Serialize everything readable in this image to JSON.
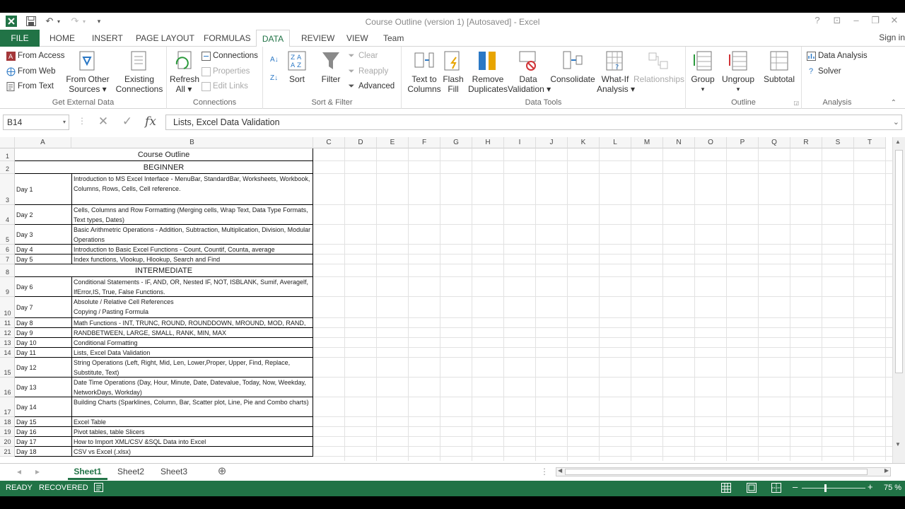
{
  "window": {
    "title": "Course Outline (version 1) [Autosaved] - Excel",
    "help": "?",
    "restore_ribbon": "⊡",
    "minimize": "–",
    "maximize": "❐",
    "close": "✕",
    "signin": "Sign in"
  },
  "qat": {
    "undo": "↶",
    "redo": "↷",
    "customize": "▾"
  },
  "tabs": [
    "FILE",
    "HOME",
    "INSERT",
    "PAGE LAYOUT",
    "FORMULAS",
    "DATA",
    "REVIEW",
    "VIEW",
    "Team"
  ],
  "ribbon": {
    "get_external": {
      "label": "Get External Data",
      "from_access": "From Access",
      "from_web": "From Web",
      "from_text": "From Text",
      "other_l1": "From Other",
      "other_l2": "Sources",
      "existing_l1": "Existing",
      "existing_l2": "Connections"
    },
    "connections": {
      "label": "Connections",
      "refresh_l1": "Refresh",
      "refresh_l2": "All",
      "connections": "Connections",
      "properties": "Properties",
      "edit_links": "Edit Links"
    },
    "sort_filter": {
      "label": "Sort & Filter",
      "sort": "Sort",
      "filter": "Filter",
      "clear": "Clear",
      "reapply": "Reapply",
      "advanced": "Advanced"
    },
    "data_tools": {
      "label": "Data Tools",
      "ttc_l1": "Text to",
      "ttc_l2": "Columns",
      "flash_l1": "Flash",
      "flash_l2": "Fill",
      "remove_l1": "Remove",
      "remove_l2": "Duplicates",
      "dv_l1": "Data",
      "dv_l2": "Validation",
      "consolidate": "Consolidate",
      "whatif_l1": "What-If",
      "whatif_l2": "Analysis",
      "relationships": "Relationships"
    },
    "outline": {
      "label": "Outline",
      "group": "Group",
      "ungroup": "Ungroup",
      "subtotal": "Subtotal"
    },
    "analysis": {
      "label": "Analysis",
      "data_analysis": "Data Analysis",
      "solver": "Solver"
    }
  },
  "formula_bar": {
    "name_box": "B14",
    "cancel": "✕",
    "enter": "✓",
    "fx": "fx",
    "value": "Lists, Excel Data Validation"
  },
  "columns": [
    "A",
    "B",
    "C",
    "D",
    "E",
    "F",
    "G",
    "H",
    "I",
    "J",
    "K",
    "L",
    "M",
    "N",
    "O",
    "P",
    "Q",
    "R",
    "S",
    "T"
  ],
  "rows": [
    {
      "n": "1",
      "b": "Course Outline"
    },
    {
      "n": "2",
      "b": "BEGINNER"
    },
    {
      "n": "3",
      "a": "Day 1",
      "b": "Introduction to MS Excel Interface - MenuBar, StandardBar, Worksheets, Workbook, Columns, Rows, Cells, Cell reference."
    },
    {
      "n": "4",
      "a": "Day 2",
      "b": "Cells, Columns and Row Formatting (Merging cells, Wrap Text, Data Type Formats, Text types, Dates)"
    },
    {
      "n": "5",
      "a": "Day 3",
      "b": "Basic Arithmetric Operations - Addition, Subtraction, Multiplication, Division, Modular Operations"
    },
    {
      "n": "6",
      "a": "Day 4",
      "b": "Introduction to Basic Excel Functions - Count, Countif, Counta, average"
    },
    {
      "n": "7",
      "a": "Day 5",
      "b": "Index functions, Vlookup, Hlookup, Search and Find"
    },
    {
      "n": "8",
      "b": "INTERMEDIATE"
    },
    {
      "n": "9",
      "a": "Day 6",
      "b": "Conditional Statements - IF, AND, OR, Nested IF, NOT, ISBLANK, Sumif, Averagelf, IfError,IS, True, False  Functions."
    },
    {
      "n": "10",
      "a": "Day 7",
      "b": "Absolute / Relative Cell References\nCopying / Pasting Formula"
    },
    {
      "n": "11",
      "a": "Day 8",
      "b": "Math Functions - INT, TRUNC, ROUND, ROUNDDOWN, MROUND, MOD, RAND,"
    },
    {
      "n": "12",
      "a": "Day 9",
      "b": "RANDBETWEEN, LARGE, SMALL, RANK, MIN, MAX"
    },
    {
      "n": "13",
      "a": "Day 10",
      "b": "Conditional Formatting"
    },
    {
      "n": "14",
      "a": "Day 11",
      "b": "Lists, Excel Data Validation"
    },
    {
      "n": "15",
      "a": "Day 12",
      "b": "String Operations (Left, Right, Mid, Len, Lower,Proper, Upper, Find, Replace, Substitute, Text)"
    },
    {
      "n": "16",
      "a": "Day 13",
      "b": "Date Time Operations (Day, Hour, Minute, Date, Datevalue, Today, Now, Weekday, NetworkDays, Workday)"
    },
    {
      "n": "17",
      "a": "Day 14",
      "b": "Building Charts (Sparklines, Column, Bar, Scatter plot, Line, Pie and Combo charts)"
    },
    {
      "n": "18",
      "a": "Day 15",
      "b": "Excel Table"
    },
    {
      "n": "19",
      "a": "Day 16",
      "b": "Pivot tables, table Slicers"
    },
    {
      "n": "20",
      "a": "Day 17",
      "b": "How to Import XML/CSV &SQL Data into Excel"
    },
    {
      "n": "21",
      "a": "Day 18",
      "b": "CSV vs Excel (.xlsx)"
    }
  ],
  "sheets": [
    "Sheet1",
    "Sheet2",
    "Sheet3"
  ],
  "sheet_nav": {
    "prev": "◂",
    "next": "▸",
    "more": "⋮",
    "add": "⊕"
  },
  "status": {
    "ready": "READY",
    "recovered": "RECOVERED",
    "zoom_out": "–",
    "zoom_in": "+",
    "zoom": "75 %"
  },
  "zoom_level": 0.75,
  "colors": {
    "accent": "#217346"
  }
}
